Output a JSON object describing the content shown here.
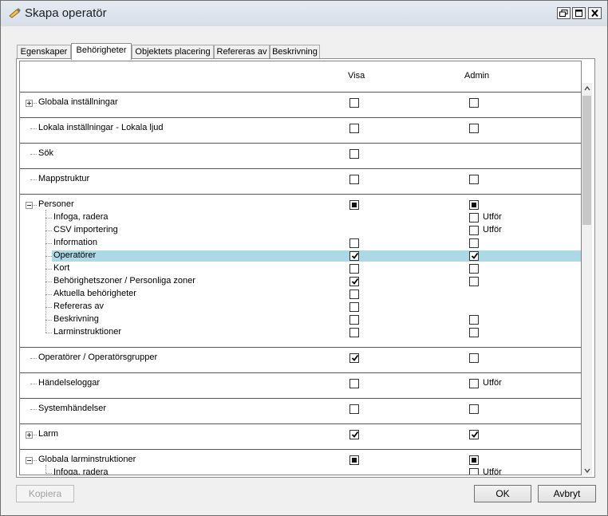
{
  "window": {
    "title": "Skapa operatör"
  },
  "tabs": [
    "Egenskaper",
    "Behörigheter",
    "Objektets placering",
    "Refereras av",
    "Beskrivning"
  ],
  "active_tab": "Behörigheter",
  "columns": {
    "visa": "Visa",
    "admin": "Admin"
  },
  "utfor_label": "Utför",
  "groups": [
    {
      "label": "Globala inställningar",
      "expander": "plus",
      "visa": "unchecked",
      "admin": "unchecked"
    },
    {
      "label": "Lokala inställningar - Lokala ljud",
      "expander": "none",
      "visa": "unchecked",
      "admin": "unchecked"
    },
    {
      "label": "Sök",
      "expander": "none",
      "visa": "unchecked",
      "admin": "none"
    },
    {
      "label": "Mappstruktur",
      "expander": "none",
      "visa": "unchecked",
      "admin": "unchecked"
    },
    {
      "label": "Personer",
      "expander": "minus",
      "visa": "indeterminate",
      "admin": "indeterminate",
      "children": [
        {
          "label": "Infoga, radera",
          "visa": "none",
          "admin": "unchecked",
          "admin_utfor": true
        },
        {
          "label": "CSV importering",
          "visa": "none",
          "admin": "unchecked",
          "admin_utfor": true
        },
        {
          "label": "Information",
          "visa": "unchecked",
          "admin": "unchecked"
        },
        {
          "label": "Operatörer",
          "visa": "checked",
          "admin": "checked",
          "selected": true
        },
        {
          "label": "Kort",
          "visa": "unchecked",
          "admin": "unchecked"
        },
        {
          "label": "Behörighetszoner / Personliga zoner",
          "visa": "checked",
          "admin": "unchecked"
        },
        {
          "label": "Aktuella behörigheter",
          "visa": "unchecked",
          "admin": "none"
        },
        {
          "label": "Refereras av",
          "visa": "unchecked",
          "admin": "none"
        },
        {
          "label": "Beskrivning",
          "visa": "unchecked",
          "admin": "unchecked"
        },
        {
          "label": "Larminstruktioner",
          "visa": "unchecked",
          "admin": "unchecked"
        }
      ]
    },
    {
      "label": "Operatörer / Operatörsgrupper",
      "expander": "none",
      "visa": "checked",
      "admin": "unchecked"
    },
    {
      "label": "Händelseloggar",
      "expander": "none",
      "visa": "unchecked",
      "admin": "unchecked",
      "admin_utfor": true
    },
    {
      "label": "Systemhändelser",
      "expander": "none",
      "visa": "unchecked",
      "admin": "unchecked"
    },
    {
      "label": "Larm",
      "expander": "plus",
      "visa": "checked",
      "admin": "checked"
    },
    {
      "label": "Globala larminstruktioner",
      "expander": "minus",
      "visa": "indeterminate",
      "admin": "indeterminate",
      "children": [
        {
          "label": "Infoga, radera",
          "visa": "none",
          "admin": "unchecked",
          "admin_utfor": true
        }
      ]
    }
  ],
  "buttons": {
    "copy": "Kopiera",
    "ok": "OK",
    "cancel": "Avbryt"
  }
}
